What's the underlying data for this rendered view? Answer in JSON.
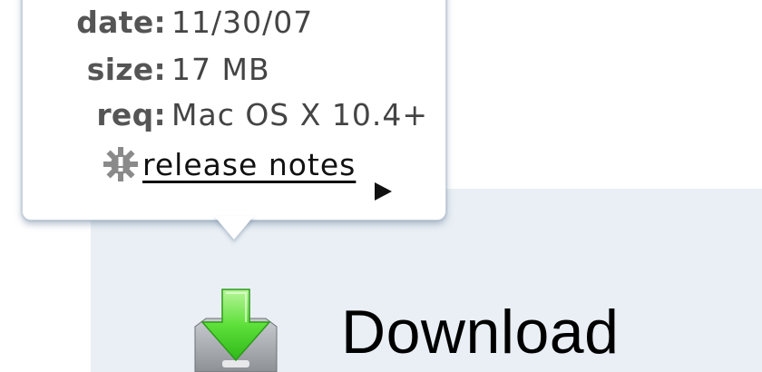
{
  "popover": {
    "rows": [
      {
        "key": "date:",
        "value": "11/30/07"
      },
      {
        "key": "size:",
        "value": "17 MB"
      },
      {
        "key": "req:",
        "value": "Mac OS X 10.4+"
      }
    ],
    "release_notes_label": "release notes",
    "gear_icon": "gear-icon",
    "arrow_icon": "play-arrow-icon"
  },
  "download": {
    "label": "Download",
    "icon": "download-arrow-icon",
    "accent_color": "#4cd32a",
    "panel_color": "#e9eff4"
  }
}
